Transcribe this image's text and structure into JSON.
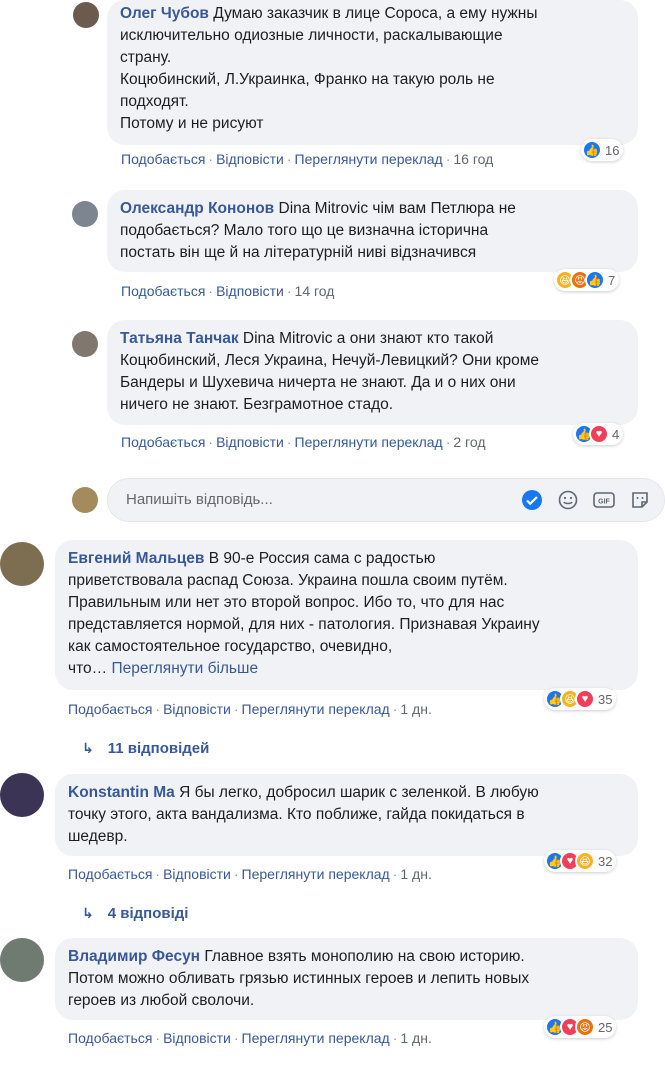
{
  "comments": [
    {
      "author": "Олег Чубов",
      "text": "Думаю заказчик в лице Сороса, а ему нужны\nисключительно одиозные личности, раскалывающие\nстрану.\nКоцюбинский, Л.Украинка, Франко на такую роль не\nподходят.\nПотому и не рисуют",
      "like_label": "Подобається",
      "reply_label": "Відповісти",
      "translate_label": "Переглянути переклад",
      "time": "16 год",
      "reactions": [
        "like"
      ],
      "reaction_count": "16"
    },
    {
      "author": "Олександр Кононов",
      "text": "Dina Mitrovic чім вам Петлюра не\nподобається? Мало того що це визначна історична\nпостать він ще й на літературній ниві відзначився",
      "like_label": "Подобається",
      "reply_label": "Відповісти",
      "time": "14 год",
      "reactions": [
        "haha",
        "angry",
        "like"
      ],
      "reaction_count": "7"
    },
    {
      "author": "Татьяна Танчак",
      "text": "Dina Mitrovic а они знают кто такой\nКоцюбинский, Леся Украина, Нечуй-Левицкий? Они кроме\nБандеры и Шухевича ничерта не знают. Да и о них они\nничего не знают. Безграмотное стадо.",
      "like_label": "Подобається",
      "reply_label": "Відповісти",
      "translate_label": "Переглянути переклад",
      "time": "2 год",
      "reactions": [
        "like",
        "love"
      ],
      "reaction_count": "4"
    },
    {
      "author": "Евгений Мальцев",
      "text": "В 90-е Россия сама с радостью\nприветствовала распад Союза. Украина пошла своим путём.\nПравильным или нет это второй вопрос. Ибо то, что для нас\nпредставляется нормой, для них - патология. Признавая Украину\nкак самостоятельное государство, очевидно,\nчто…",
      "see_more_label": "Переглянути більше",
      "like_label": "Подобається",
      "reply_label": "Відповісти",
      "translate_label": "Переглянути переклад",
      "time": "1 дн.",
      "reactions": [
        "like",
        "haha",
        "love"
      ],
      "reaction_count": "35",
      "replies_label": "11 відповідей"
    },
    {
      "author": "Konstantin Ma",
      "text": "Я бы легко, добросил шарик с зеленкой. В любую\nточку этого, акта вандализма. Кто поближе, гайда покидаться в\nшедевр.",
      "like_label": "Подобається",
      "reply_label": "Відповісти",
      "translate_label": "Переглянути переклад",
      "time": "1 дн.",
      "reactions": [
        "like",
        "love",
        "haha"
      ],
      "reaction_count": "32",
      "replies_label": "4 відповіді"
    },
    {
      "author": "Владимир Фесун",
      "text": "Главное взять монополию на свою историю.\nПотом можно обливать грязью истинных героев и лепить новых\nгероев из любой сволочи.",
      "like_label": "Подобається",
      "reply_label": "Відповісти",
      "translate_label": "Переглянути переклад",
      "time": "1 дн.",
      "reactions": [
        "like",
        "love",
        "angry"
      ],
      "reaction_count": "25"
    }
  ],
  "reply_box": {
    "placeholder": "Напишіть відповідь...",
    "icons": [
      "sticker-check-icon",
      "emoji-icon",
      "gif-icon",
      "sticker-icon"
    ]
  },
  "colors": {
    "link": "#385898",
    "bubble_bg": "#f0f2f5",
    "like": "#1877f2",
    "love": "#f33e58",
    "haha": "#f7b125",
    "angry": "#e9710f"
  }
}
